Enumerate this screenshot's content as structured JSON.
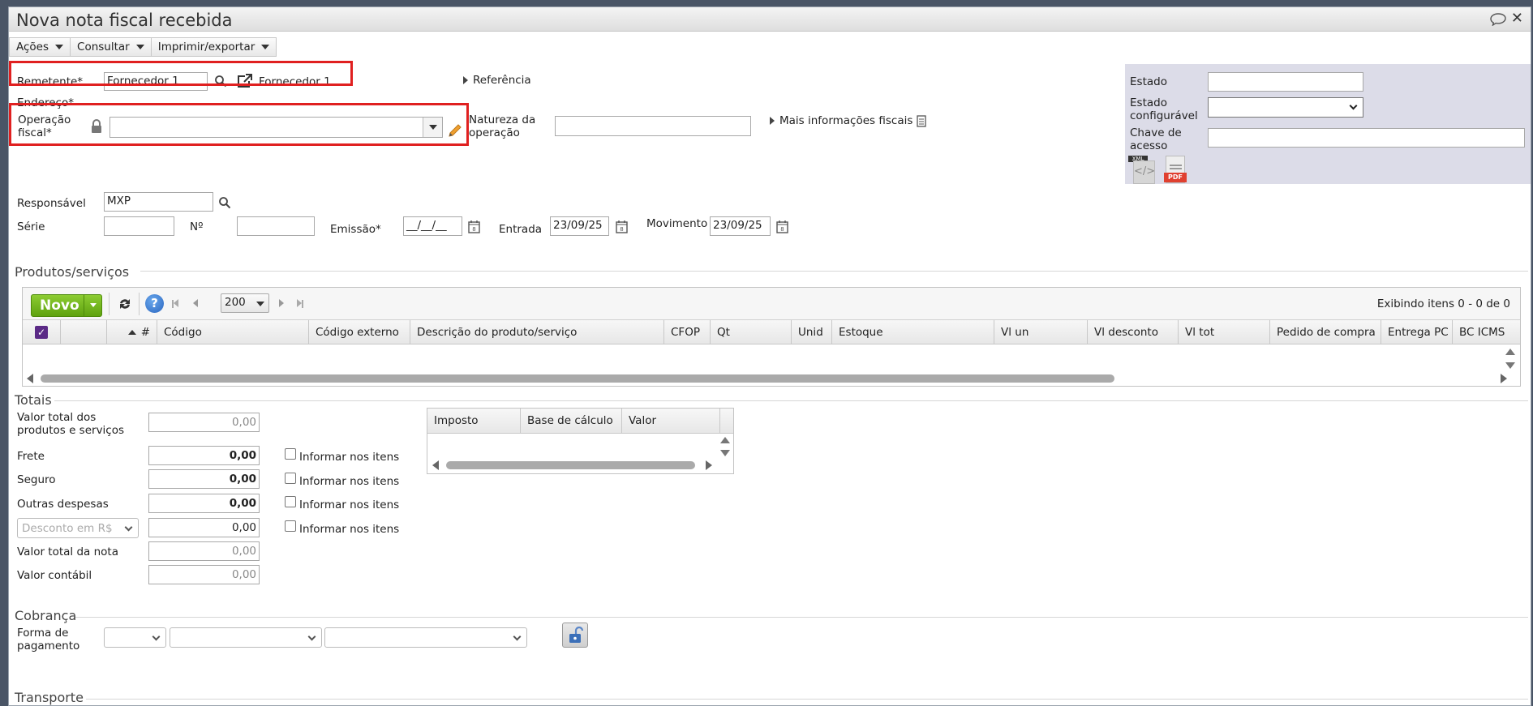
{
  "window": {
    "title": "Nova nota fiscal recebida"
  },
  "menu": [
    {
      "label": "Ações"
    },
    {
      "label": "Consultar"
    },
    {
      "label": "Imprimir/exportar"
    }
  ],
  "header": {
    "remetente_label": "Remetente*",
    "remetente_value": "Fornecedor 1",
    "remetente_link": "Fornecedor 1",
    "referencia": "Referência",
    "endereco_label": "Endereço*",
    "operacao_label": "Operação fiscal*",
    "natureza_label": "Natureza da operação",
    "mais_info": "Mais informações fiscais",
    "responsavel_label": "Responsável",
    "responsavel_value": "MXP",
    "serie_label": "Série",
    "numero_label": "Nº",
    "emissao_label": "Emissão*",
    "emissao_value": "__/__/__",
    "entrada_label": "Entrada",
    "entrada_value": "23/09/25",
    "movimento_label": "Movimento",
    "movimento_value": "23/09/25"
  },
  "fiscal": {
    "estado_label": "Estado",
    "estado_config_label": "Estado configurável",
    "chave_label": "Chave de acesso",
    "xml_label": "XML",
    "pdf_label": "PDF"
  },
  "produtos": {
    "title": "Produtos/serviços",
    "novo": "Novo",
    "page_size": "200",
    "exibindo": "Exibindo itens 0 - 0 de 0",
    "columns": [
      "#",
      "Código",
      "Código externo",
      "Descrição do produto/serviço",
      "CFOP",
      "Qt",
      "Unid",
      "Estoque",
      "Vl un",
      "Vl desconto",
      "Vl tot",
      "Pedido de compra",
      "Entrega PC",
      "BC ICMS"
    ]
  },
  "totais": {
    "title": "Totais",
    "rows": [
      {
        "label": "Valor total dos produtos e serviços",
        "value": "0,00"
      },
      {
        "label": "Frete",
        "value": "0,00",
        "informar": "Informar nos itens"
      },
      {
        "label": "Seguro",
        "value": "0,00",
        "informar": "Informar nos itens"
      },
      {
        "label": "Outras despesas",
        "value": "0,00",
        "informar": "Informar nos itens"
      },
      {
        "label": "Desconto em R$",
        "value": "0,00",
        "informar": "Informar nos itens"
      },
      {
        "label": "Valor total da nota",
        "value": "0,00"
      },
      {
        "label": "Valor contábil",
        "value": "0,00"
      }
    ],
    "tax_columns": [
      "Imposto",
      "Base de cálculo",
      "Valor"
    ]
  },
  "cobranca": {
    "title": "Cobrança",
    "forma_label": "Forma de pagamento"
  },
  "transporte": {
    "title": "Transporte"
  },
  "colors": {
    "accent_green": "#6db31e",
    "highlight_red": "#e02020",
    "panel_bg": "#dcdce8"
  }
}
